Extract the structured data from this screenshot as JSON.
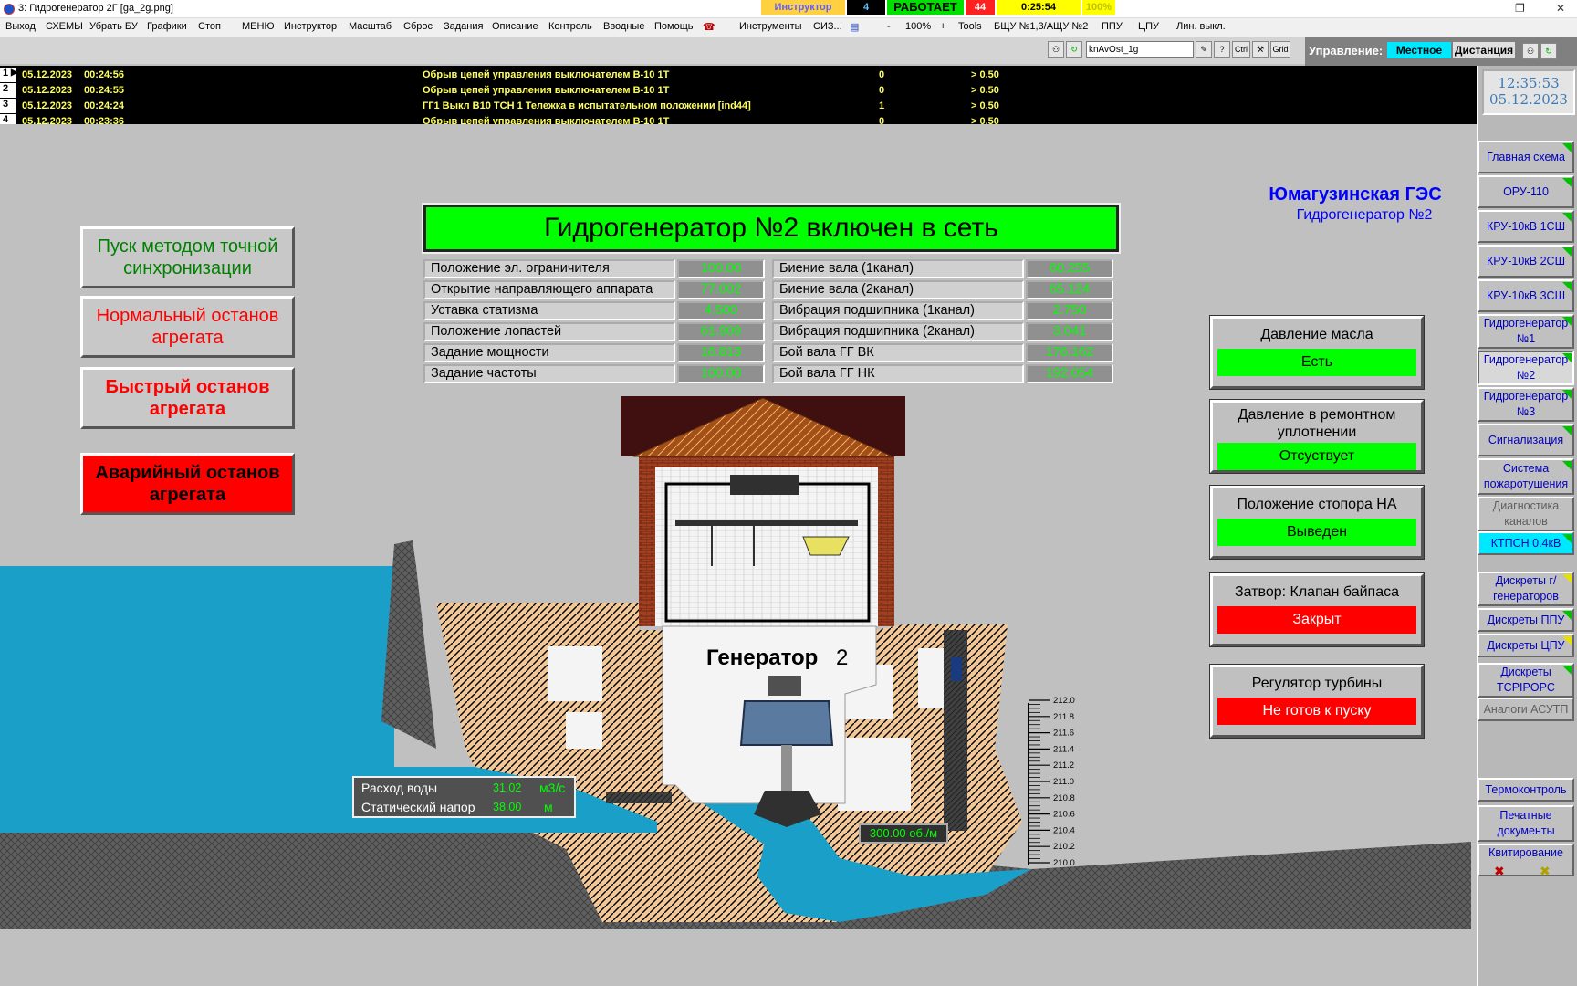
{
  "window": {
    "title": "3: Гидрогенератор 2Г [ga_2g.png]",
    "instructor_label": "Инструктор",
    "counter_value": "4",
    "run_status": "РАБОТАЕТ",
    "alarm_count": "44",
    "timer": "0:25:54",
    "speed": "100%",
    "colors": {
      "running": "#00e000",
      "alarm": "#ff2020",
      "timer": "#ffff00",
      "instructor": "#ffd040"
    }
  },
  "menu": [
    "Выход",
    "СХЕМЫ",
    "Убрать БУ",
    "Графики",
    "Стоп",
    "МЕНЮ",
    "Инструктор",
    "Масштаб",
    "Сброс",
    "Задания",
    "Описание",
    "Контроль",
    "Вводные",
    "Помощь",
    "Инструменты",
    "СИЗ...",
    "-",
    "100%",
    "+",
    "Tools",
    "БЩУ №1,3/АЩУ №2",
    "ППУ",
    "ЦПУ",
    "Лин. выкл."
  ],
  "toolbar": {
    "search_value": "knAvOst_1g",
    "help_label": "?",
    "ctrl_label": "Ctrl",
    "grid_label": "Grid"
  },
  "control": {
    "label": "Управление:",
    "local_label": "Местное",
    "remote_label": "Дистанция"
  },
  "events": [
    {
      "n": "1",
      "date": "05.12.2023",
      "time": "00:24:56",
      "text": "Обрыв цепей управления выключателем В-10 1Т",
      "val": "0",
      "thr": "> 0.50"
    },
    {
      "n": "2",
      "date": "05.12.2023",
      "time": "00:24:55",
      "text": "Обрыв цепей управления выключателем В-10 1Т",
      "val": "0",
      "thr": "> 0.50"
    },
    {
      "n": "3",
      "date": "05.12.2023",
      "time": "00:24:24",
      "text": "ГГ1 Выкл В10 ТСН 1 Тележка в испытательном положении [ind44]",
      "val": "1",
      "thr": "> 0.50"
    },
    {
      "n": "4",
      "date": "05.12.2023",
      "time": "00:23:36",
      "text": "Обрыв цепей управления выключателем В-10 1Т",
      "val": "0",
      "thr": "> 0.50"
    }
  ],
  "clock": {
    "time": "12:35:53",
    "date": "05.12.2023"
  },
  "nav": [
    {
      "label": "Главная схема",
      "mark": "g"
    },
    {
      "label": "ОРУ-110",
      "mark": "g"
    },
    {
      "label": "КРУ-10кВ 1СШ",
      "mark": "g"
    },
    {
      "label": "КРУ-10кВ 2СШ",
      "mark": "g"
    },
    {
      "label": "КРУ-10кВ 3СШ",
      "mark": "g"
    },
    {
      "label": "Гидрогенератор №1",
      "mark": "g"
    },
    {
      "label": "Гидрогенератор №2",
      "mark": "g"
    },
    {
      "label": "Гидрогенератор №3",
      "mark": "g"
    },
    {
      "label": "Сигнализация",
      "mark": "g"
    },
    {
      "label": "Система пожаротушения",
      "mark": "g"
    },
    {
      "label": "Диагностика каналов",
      "mark": ""
    },
    {
      "label": "КТПСН 0.4кВ",
      "mark": "g"
    },
    {
      "label": "Дискреты г/генераторов",
      "mark": "y"
    },
    {
      "label": "Дискреты ППУ",
      "mark": "g"
    },
    {
      "label": "Дискреты ЦПУ",
      "mark": "y"
    },
    {
      "label": "Дискреты TCPIPOPC",
      "mark": "g"
    },
    {
      "label": "Аналоги АСУТП",
      "mark": ""
    },
    {
      "label": "Термоконтроль",
      "mark": ""
    },
    {
      "label": "Печатные документы",
      "mark": ""
    },
    {
      "label": "Квитирование",
      "mark": ""
    }
  ],
  "station": {
    "name": "Юмагузинская ГЭС",
    "unit": "Гидрогенератор №2"
  },
  "commands": [
    {
      "label": "Пуск методом точной синхронизации",
      "color": "#008000"
    },
    {
      "label": "Нормальный останов агрегата",
      "color": "#ff0000"
    },
    {
      "label": "Быстрый останов агрегата",
      "color": "#ff0000"
    },
    {
      "label": "Аварийный останов агрегата",
      "color": "#000000"
    }
  ],
  "banner": "Гидрогенератор №2 включен в сеть",
  "params_left": [
    {
      "label": "Положение эл. ограничителя",
      "value": "100.00"
    },
    {
      "label": "Открытие направляющего аппарата",
      "value": "77.002"
    },
    {
      "label": "Уставка статизма",
      "value": "4.500"
    },
    {
      "label": "Положение лопастей",
      "value": "61.909"
    },
    {
      "label": "Задание мощности",
      "value": "16.813"
    },
    {
      "label": "Задание частоты",
      "value": "100.00"
    }
  ],
  "params_right": [
    {
      "label": "Биение вала (1канал)",
      "value": "60.255"
    },
    {
      "label": "Биение вала (2канал)",
      "value": "65.124"
    },
    {
      "label": "Вибрация подшипника (1канал)",
      "value": "2.750"
    },
    {
      "label": "Вибрация подшипника (2канал)",
      "value": "3.041"
    },
    {
      "label": "Бой вала ГГ ВК",
      "value": "176.162"
    },
    {
      "label": "Бой вала ГГ НК",
      "value": "192.054"
    }
  ],
  "statuses": [
    {
      "title": "Давление масла",
      "value": "Есть",
      "state": "green"
    },
    {
      "title": "Давление в ремонтном уплотнении",
      "value": "Отсуствует",
      "state": "green"
    },
    {
      "title": "Положение стопора НА",
      "value": "Выведен",
      "state": "green"
    },
    {
      "title": "Затвор: Клапан байпаса",
      "value": "Закрыт",
      "state": "red"
    },
    {
      "title": "Регулятор турбины",
      "value": "Не готов к пуску",
      "state": "red"
    }
  ],
  "generator_label": "Генератор",
  "generator_num": "2",
  "flow": {
    "label": "Расход воды",
    "value": "31.02",
    "unit": "м3/с"
  },
  "head": {
    "label": "Статический напор",
    "value": "38.00",
    "unit": "м"
  },
  "rpm": "300.00  об./м",
  "scale_ticks": [
    "212.0",
    "211.8",
    "211.6",
    "211.4",
    "211.2",
    "211.0",
    "210.8",
    "210.6",
    "210.4",
    "210.2",
    "210.0"
  ]
}
